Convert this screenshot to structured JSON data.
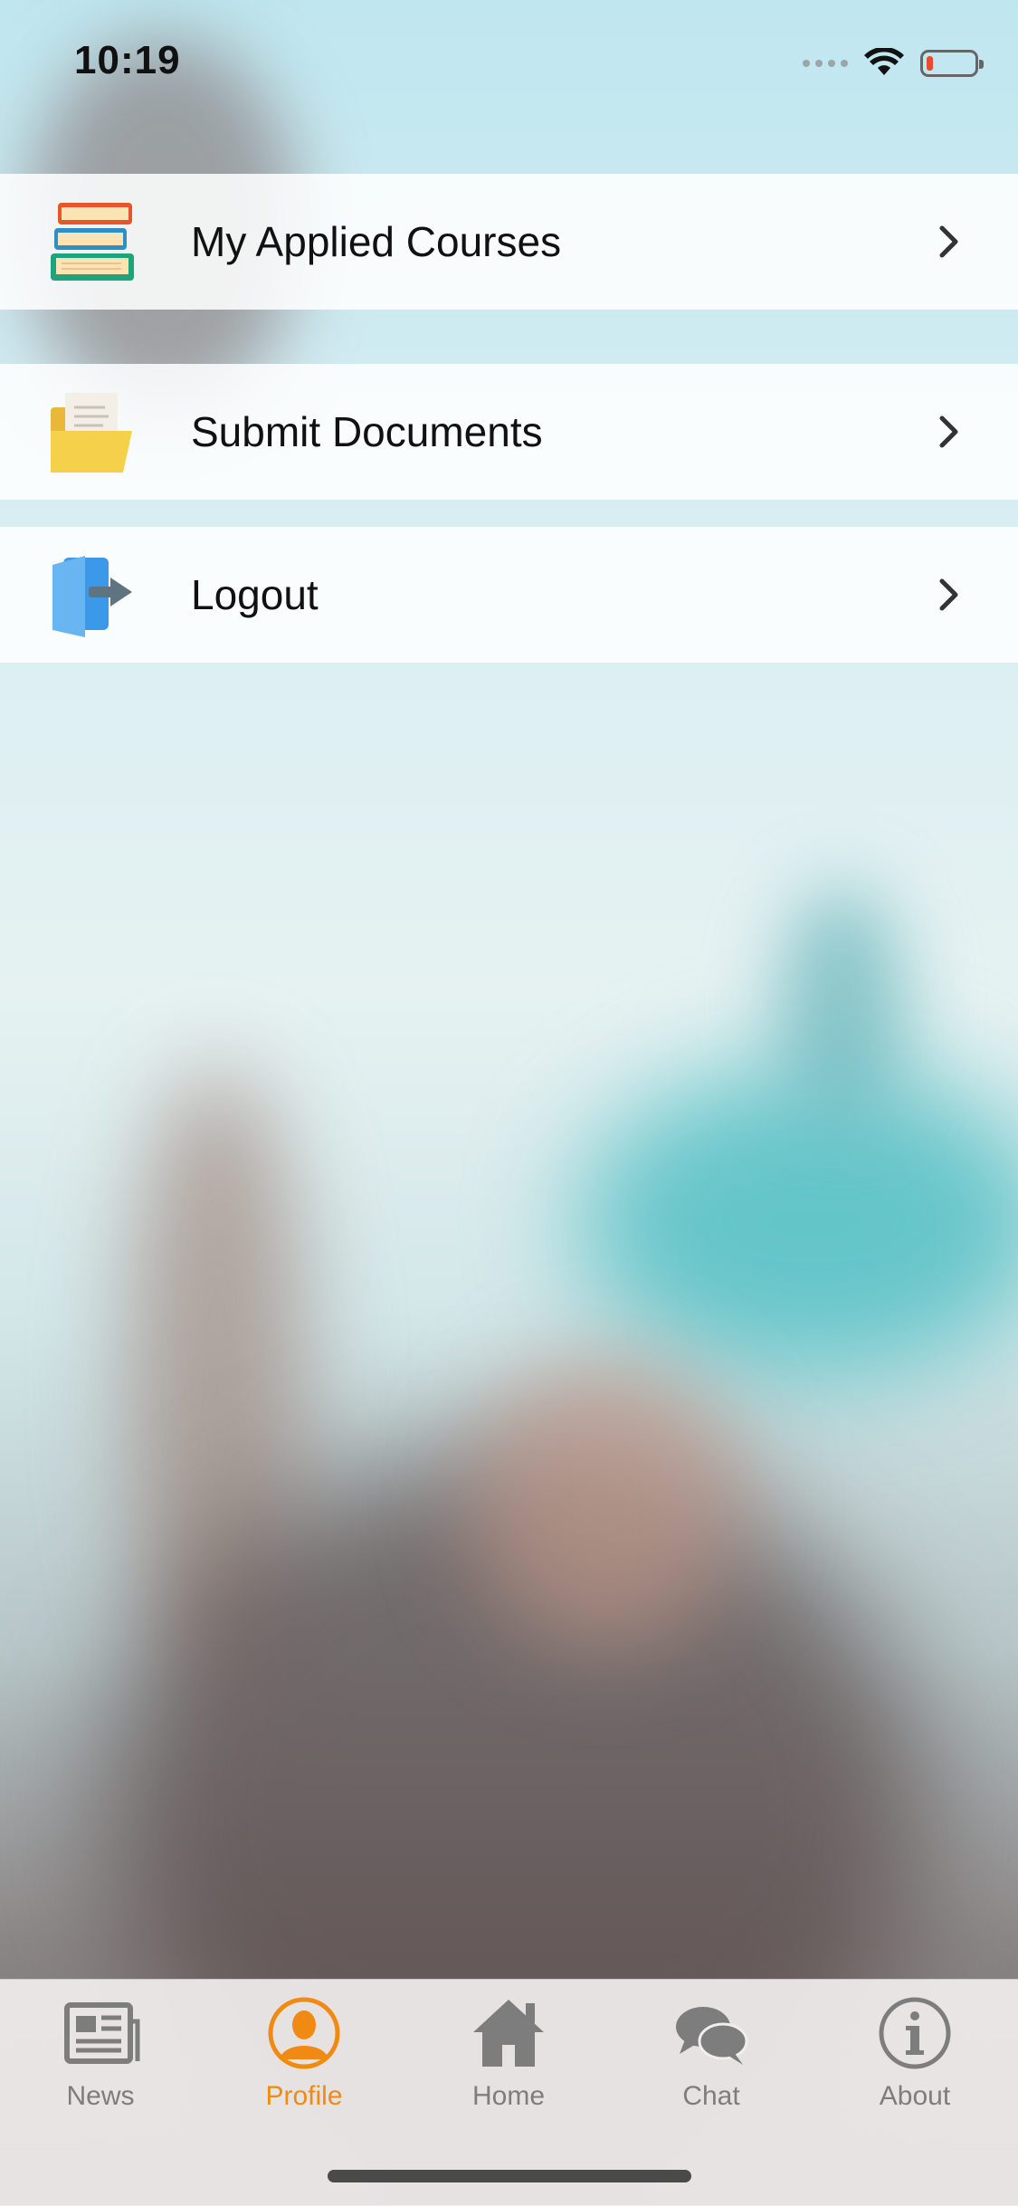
{
  "status_bar": {
    "time": "10:19"
  },
  "menu": {
    "items": [
      {
        "label": "My Applied Courses",
        "icon": "books-icon"
      },
      {
        "label": "Submit Documents",
        "icon": "folder-documents-icon"
      },
      {
        "label": "Logout",
        "icon": "logout-door-icon"
      }
    ]
  },
  "tab_bar": {
    "tabs": [
      {
        "label": "News",
        "icon": "newspaper-icon",
        "active": false
      },
      {
        "label": "Profile",
        "icon": "profile-person-icon",
        "active": true
      },
      {
        "label": "Home",
        "icon": "house-icon",
        "active": false
      },
      {
        "label": "Chat",
        "icon": "chat-bubbles-icon",
        "active": false
      },
      {
        "label": "About",
        "icon": "info-icon",
        "active": false
      }
    ]
  },
  "colors": {
    "accent": "#f08a12",
    "inactive_tab": "#7d7d7d",
    "battery_low": "#ea4b2a"
  }
}
